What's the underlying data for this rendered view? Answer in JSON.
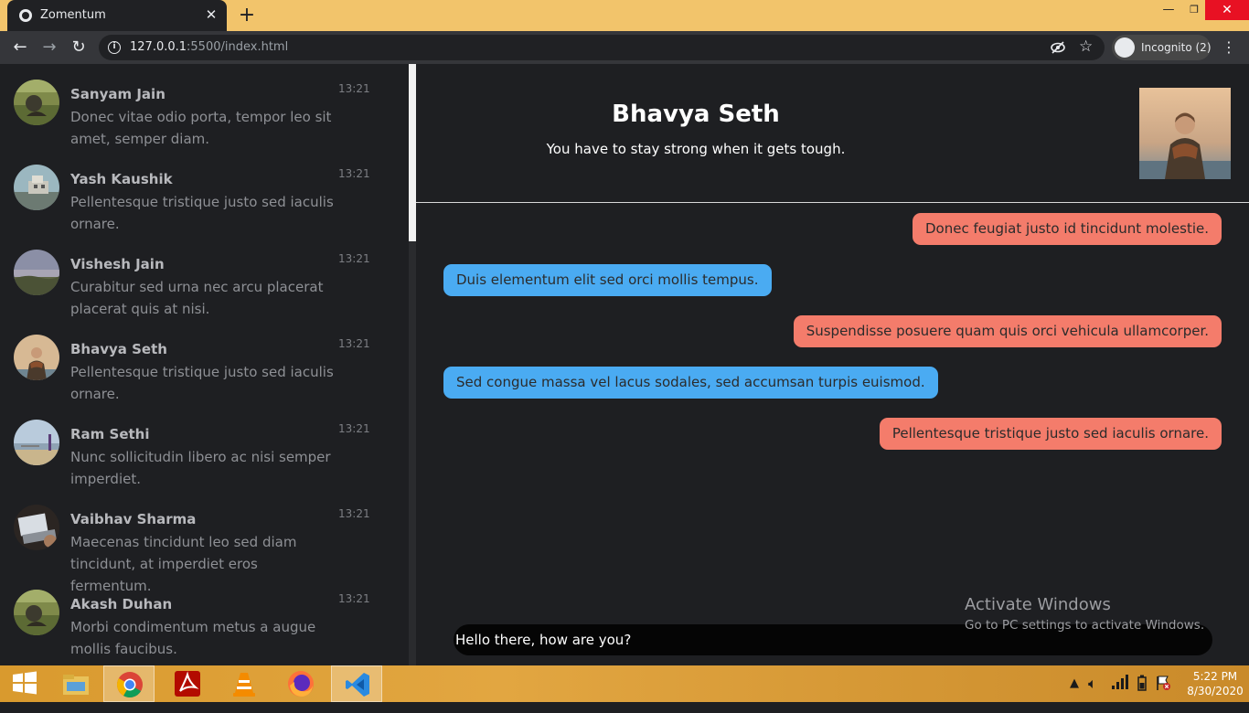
{
  "browser": {
    "tab_title": "Zomentum",
    "url_host": "127.0.0.1",
    "url_path": ":5500/index.html",
    "incognito_label": "Incognito (2)"
  },
  "contacts": [
    {
      "name": "Sanyam Jain",
      "preview": "Donec vitae odio porta, tempor leo sit amet, semper diam.",
      "time": "13:21",
      "avatar": "field-photo"
    },
    {
      "name": "Yash Kaushik",
      "preview": "Pellentesque tristique justo sed iaculis ornare.",
      "time": "13:21",
      "avatar": "building-photo"
    },
    {
      "name": "Vishesh Jain",
      "preview": "Curabitur sed urna nec arcu placerat placerat quis at nisi.",
      "time": "13:21",
      "avatar": "landscape-photo"
    },
    {
      "name": "Bhavya Seth",
      "preview": "Pellentesque tristique justo sed iaculis ornare.",
      "time": "13:21",
      "avatar": "person-photo"
    },
    {
      "name": "Ram Sethi",
      "preview": "Nunc sollicitudin libero ac nisi semper imperdiet.",
      "time": "13:21",
      "avatar": "beach-photo"
    },
    {
      "name": "Vaibhav Sharma",
      "preview": "Maecenas tincidunt leo sed diam tincidunt, at imperdiet eros fermentum.",
      "time": "13:21",
      "avatar": "laptop-photo"
    },
    {
      "name": "Akash Duhan",
      "preview": "Morbi condimentum metus a augue mollis faucibus.",
      "time": "13:21",
      "avatar": "field-photo"
    }
  ],
  "chat": {
    "name": "Bhavya Seth",
    "status": "You have to stay strong when it gets tough.",
    "messages": [
      {
        "direction": "out",
        "text": "Donec feugiat justo id tincidunt molestie."
      },
      {
        "direction": "in",
        "text": "Duis elementum elit sed orci mollis tempus."
      },
      {
        "direction": "out",
        "text": "Suspendisse posuere quam quis orci vehicula ullamcorper."
      },
      {
        "direction": "in",
        "text": "Sed congue massa vel lacus sodales, sed accumsan turpis euismod."
      },
      {
        "direction": "out",
        "text": "Pellentesque tristique justo sed iaculis ornare."
      }
    ],
    "composer_value": "Hello there, how are you?"
  },
  "watermark": {
    "title": "Activate Windows",
    "subtitle": "Go to PC settings to activate Windows."
  },
  "taskbar": {
    "time": "5:22 PM",
    "date": "8/30/2020",
    "apps": [
      "start-icon",
      "file-explorer-icon",
      "chrome-icon",
      "acrobat-icon",
      "vlc-icon",
      "firefox-icon",
      "vscode-icon"
    ]
  },
  "colors": {
    "incoming_bubble": "#4aabf2",
    "outgoing_bubble": "#f47c6b",
    "background": "#1e1f22",
    "tab_strip": "#f2c46b"
  }
}
